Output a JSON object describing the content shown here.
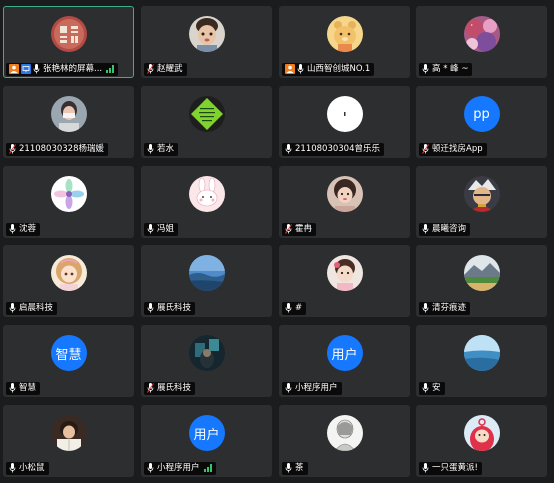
{
  "participants": [
    {
      "name": "张艳林的屏幕...",
      "avatar": "seal-icon",
      "host_badge": true,
      "share_badge": true,
      "signal": true,
      "active": true
    },
    {
      "name": "赵耀武",
      "avatar": "child-photo-icon",
      "mic": false
    },
    {
      "name": "山西智创城NO.1",
      "avatar": "cartoon-bear-icon",
      "host_badge": true
    },
    {
      "name": "高 * 峰 ~",
      "avatar": "pink-photo-icon"
    },
    {
      "name": "21108030328杨瑞媛",
      "avatar": "person-photo-icon",
      "mic": false
    },
    {
      "name": "若水",
      "avatar": "green-diamond-icon"
    },
    {
      "name": "21108030304曾乐乐",
      "avatar": "white-circle-icon"
    },
    {
      "name": "顿迁找房App",
      "avatar_text": "pp",
      "mic": false
    },
    {
      "name": "沈蓉",
      "avatar": "flower-icon"
    },
    {
      "name": "冯姐",
      "avatar": "bunny-icon"
    },
    {
      "name": "霍冉",
      "avatar": "girl-photo-icon",
      "mic": false
    },
    {
      "name": "晨曦咨询",
      "avatar": "anime-icon"
    },
    {
      "name": "启晨科技",
      "avatar": "anime-girl-icon"
    },
    {
      "name": "展氏科技",
      "avatar": "sky-photo-icon"
    },
    {
      "name": "#",
      "avatar": "kid-photo-icon"
    },
    {
      "name": "清芬痕迹",
      "avatar": "landscape-icon"
    },
    {
      "name": "智慧",
      "avatar_text": "智慧"
    },
    {
      "name": "展氏科技",
      "avatar": "dark-photo-icon",
      "mic": false
    },
    {
      "name": "小程序用户",
      "avatar_text": "用户"
    },
    {
      "name": "安",
      "avatar": "sea-photo-icon"
    },
    {
      "name": "小松鼠",
      "avatar": "reader-photo-icon"
    },
    {
      "name": "小程序用户",
      "avatar_text": "用户",
      "signal": true
    },
    {
      "name": "茶",
      "avatar": "sketch-icon"
    },
    {
      "name": "一只蛋黄派!",
      "avatar": "teletubby-icon"
    }
  ],
  "colors": {
    "background": "#1b1c1e",
    "tile": "#2d2e30",
    "active_border": "#3fae86",
    "text_avatar": "#1677ff",
    "host_badge": "#f07c1b",
    "share_badge": "#2b77e6",
    "signal": "#36c36b"
  }
}
